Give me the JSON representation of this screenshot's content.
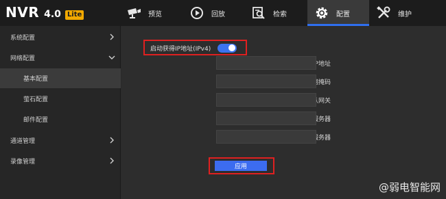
{
  "logo": {
    "main": "NVR",
    "version": "4.0",
    "badge": "Lite"
  },
  "nav": {
    "tabs": [
      {
        "label": "预览",
        "icon": "camera-icon"
      },
      {
        "label": "回放",
        "icon": "playback-icon"
      },
      {
        "label": "检索",
        "icon": "search-icon"
      },
      {
        "label": "配置",
        "icon": "gear-icon",
        "active": true
      },
      {
        "label": "维护",
        "icon": "tools-icon"
      }
    ]
  },
  "sidebar": {
    "items": [
      {
        "label": "系统配置",
        "chevron": "right"
      },
      {
        "label": "网络配置",
        "chevron": "down"
      },
      {
        "label": "基本配置",
        "active": true
      },
      {
        "label": "萤石配置"
      },
      {
        "label": "邮件配置"
      },
      {
        "label": "通道管理",
        "chevron": "right"
      },
      {
        "label": "录像管理",
        "chevron": "right"
      }
    ]
  },
  "form": {
    "dhcp_label": "启动获得IP地址(IPv4)",
    "dhcp_enabled": true,
    "fields": [
      {
        "label": "IP地址",
        "value": ""
      },
      {
        "label": "子网掩码",
        "value": ""
      },
      {
        "label": "默认网关",
        "value": ""
      },
      {
        "label": "首选DNS服务器",
        "value": ""
      },
      {
        "label": "备用DNS服务器",
        "value": ""
      }
    ],
    "apply_label": "应用"
  },
  "watermark": "@弱电智能网",
  "colors": {
    "accent": "#3c6cf0",
    "highlight_box": "#e02020",
    "badge": "#f2a900"
  }
}
